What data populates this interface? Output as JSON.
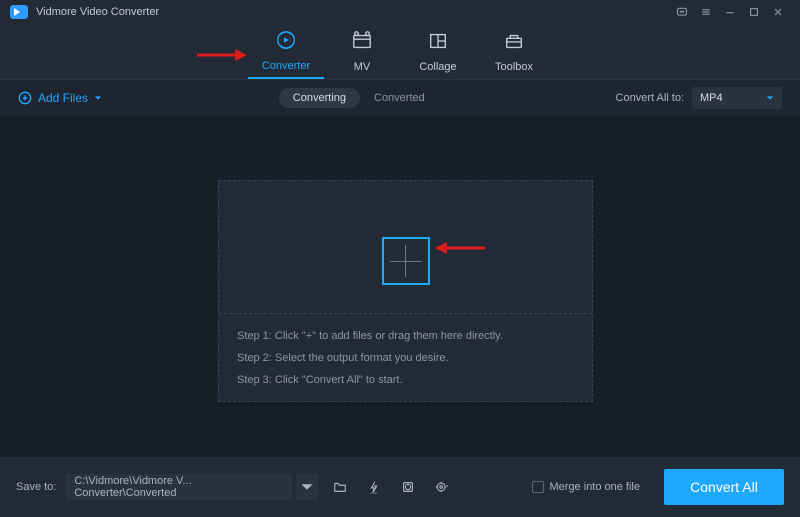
{
  "titlebar": {
    "title": "Vidmore Video Converter"
  },
  "nav": {
    "tabs": [
      {
        "label": "Converter"
      },
      {
        "label": "MV"
      },
      {
        "label": "Collage"
      },
      {
        "label": "Toolbox"
      }
    ]
  },
  "toolbar": {
    "add_files": "Add Files",
    "seg": {
      "converting": "Converting",
      "converted": "Converted"
    },
    "convert_all_to_label": "Convert All to:",
    "convert_all_to_value": "MP4"
  },
  "dropzone": {
    "step1": "Step 1: Click \"+\" to add files or drag them here directly.",
    "step2": "Step 2: Select the output format you desire.",
    "step3": "Step 3: Click \"Convert All\" to start."
  },
  "bottombar": {
    "saveto_label": "Save to:",
    "path": "C:\\Vidmore\\Vidmore V... Converter\\Converted",
    "merge_label": "Merge into one file",
    "convert_label": "Convert All"
  }
}
